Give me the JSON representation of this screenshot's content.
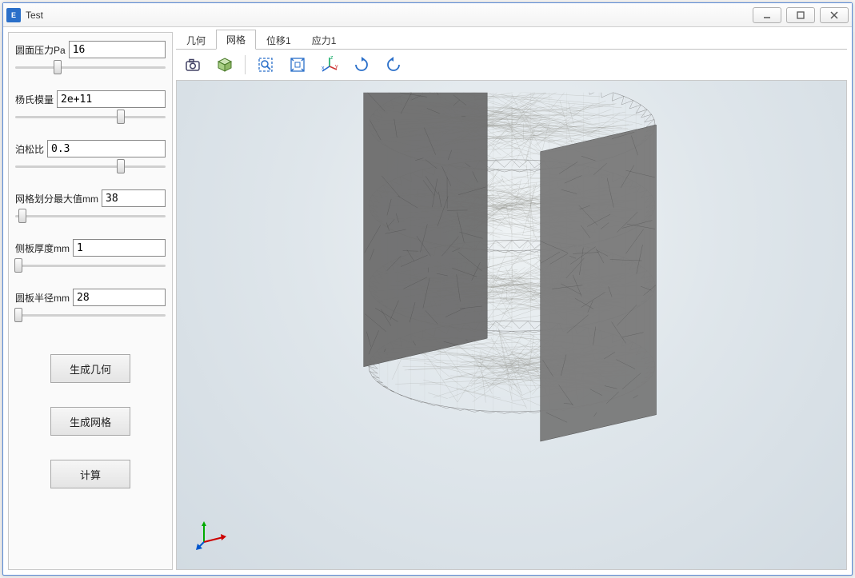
{
  "window": {
    "title": "Test",
    "icon_letter": "E"
  },
  "params": {
    "pressure": {
      "label": "圆面压力Pa",
      "value": "16",
      "slider_pct": 28
    },
    "youngs": {
      "label": "杨氏模量",
      "value": "2e+11",
      "slider_pct": 70
    },
    "poisson": {
      "label": "泊松比",
      "value": "0.3",
      "slider_pct": 70
    },
    "meshmax": {
      "label": "网格划分最大值mm",
      "value": "38",
      "slider_pct": 5
    },
    "thick": {
      "label": "侧板厚度mm",
      "value": "1",
      "slider_pct": 2
    },
    "radius": {
      "label": "圆板半径mm",
      "value": "28",
      "slider_pct": 2
    }
  },
  "buttons": {
    "gen_geom": "生成几何",
    "gen_mesh": "生成网格",
    "compute": "计算"
  },
  "tabs": {
    "geometry": "几何",
    "mesh": "网格",
    "disp1": "位移1",
    "stress1": "应力1"
  },
  "active_tab": "mesh",
  "toolbar_icons": {
    "camera": "camera-icon",
    "cube": "selection-cube-icon",
    "zoombox": "zoom-box-icon",
    "fit": "zoom-fit-icon",
    "axes": "axes-icon",
    "rotcw": "rotate-cw-icon",
    "rotccw": "rotate-ccw-icon"
  },
  "colors": {
    "accent": "#2a6fc9",
    "border": "#5a8bd6"
  }
}
